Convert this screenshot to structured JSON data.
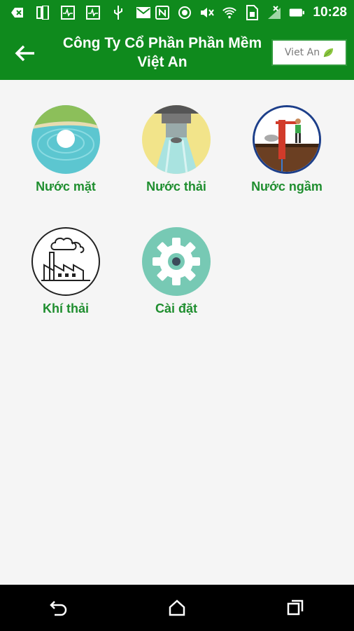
{
  "status_bar": {
    "time": "10:28",
    "left_icons": [
      "back-box-icon",
      "phone-icon",
      "activity-icon",
      "activity-icon",
      "usb-icon",
      "gmail-icon"
    ],
    "right_icons": [
      "nfc-icon",
      "circle-icon",
      "mute-icon",
      "wifi-icon",
      "sim-icon",
      "signal-icon",
      "battery-icon"
    ]
  },
  "app_bar": {
    "title": "Công Ty Cổ Phần Phần Mềm Việt An",
    "logo_text": "Viet An"
  },
  "menu": {
    "items": [
      {
        "label": "Nước mặt"
      },
      {
        "label": "Nước thải"
      },
      {
        "label": "Nước ngầm"
      },
      {
        "label": "Khí thải"
      },
      {
        "label": "Cài đặt"
      }
    ]
  },
  "colors": {
    "primary": "#0f8a1d",
    "label": "#1f8e2f",
    "background": "#f5f5f5"
  }
}
